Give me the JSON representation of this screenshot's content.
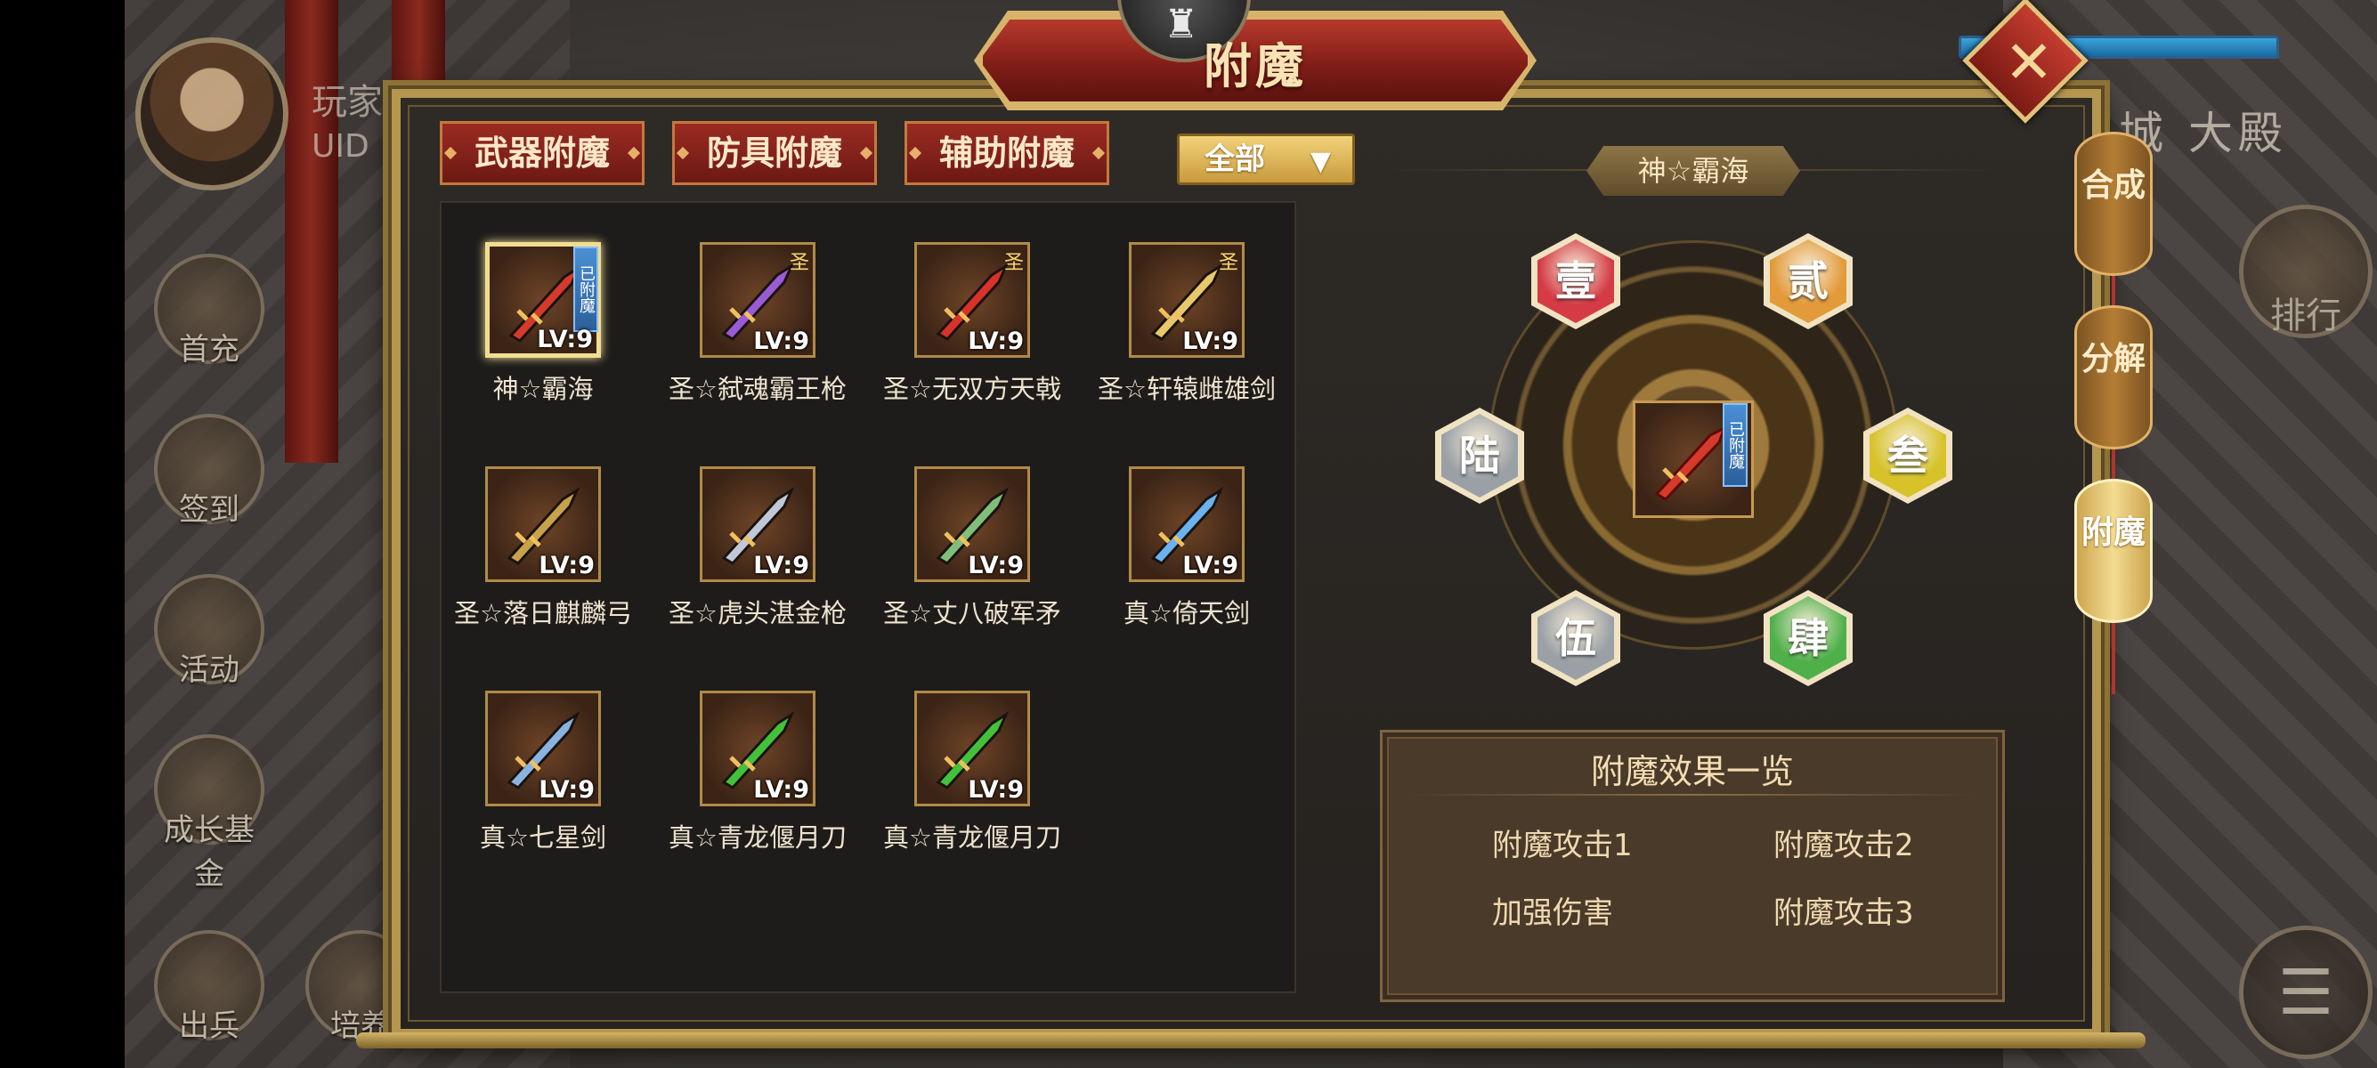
{
  "hud": {
    "player_label": "玩家",
    "uid_label": "UID",
    "left_menu": [
      "首充",
      "签到",
      "活动",
      "成长基金",
      "出兵",
      "培养"
    ],
    "right_header": "城 大殿",
    "rank_label": "排行",
    "menu_label": "☰"
  },
  "modal": {
    "title": "附魔",
    "close_label": "✕",
    "categories": [
      "武器附魔",
      "防具附魔",
      "辅助附魔"
    ],
    "filter": {
      "selected": "全部",
      "arrow": "▼"
    }
  },
  "items": [
    {
      "name": "神☆霸海",
      "level": "LV:9",
      "enchanted_tag": "已附魔",
      "selected": true,
      "color": "#d63a2a"
    },
    {
      "name": "圣☆弑魂霸王枪",
      "level": "LV:9",
      "star": "圣",
      "color": "#9a5bd6"
    },
    {
      "name": "圣☆无双方天戟",
      "level": "LV:9",
      "star": "圣",
      "color": "#d8322a"
    },
    {
      "name": "圣☆轩辕雌雄剑",
      "level": "LV:9",
      "star": "圣",
      "color": "#e8c86a"
    },
    {
      "name": "圣☆落日麒麟弓",
      "level": "LV:9",
      "color": "#c7a24a"
    },
    {
      "name": "圣☆虎头湛金枪",
      "level": "LV:9",
      "color": "#c0c8d8"
    },
    {
      "name": "圣☆丈八破军矛",
      "level": "LV:9",
      "color": "#7fbf7a"
    },
    {
      "name": "真☆倚天剑",
      "level": "LV:9",
      "color": "#6ab2f0"
    },
    {
      "name": "真☆七星剑",
      "level": "LV:9",
      "color": "#8ab4e0"
    },
    {
      "name": "真☆青龙偃月刀",
      "level": "LV:9",
      "color": "#42c23a"
    },
    {
      "name": "真☆青龙偃月刀",
      "level": "LV:9",
      "color": "#42c23a"
    }
  ],
  "wheel": {
    "weapon_name": "神☆霸海",
    "core_tag": "已附魔",
    "slots": [
      {
        "label": "壹",
        "color": "#d43b45"
      },
      {
        "label": "贰",
        "color": "#e29a3a"
      },
      {
        "label": "叁",
        "color": "#d7c22a"
      },
      {
        "label": "肆",
        "color": "#4fb04a"
      },
      {
        "label": "伍",
        "color": "#9aa0a6"
      },
      {
        "label": "陆",
        "color": "#9aa0a6"
      }
    ]
  },
  "effects": {
    "title": "附魔效果一览",
    "list": [
      "附魔攻击1",
      "附魔攻击2",
      "加强伤害",
      "附魔攻击3"
    ]
  },
  "side_tabs": [
    "合成",
    "分解",
    "附魔"
  ],
  "active_side_tab": "附魔"
}
